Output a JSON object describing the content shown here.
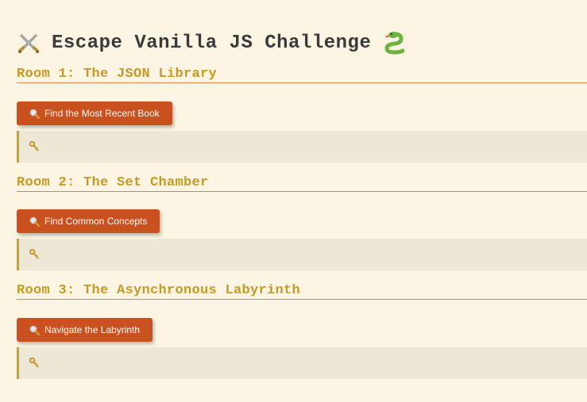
{
  "page": {
    "title": "Escape Vanilla JS Challenge",
    "title_icon_left": "crossed-swords-icon",
    "title_icon_right": "snake-icon"
  },
  "rooms": [
    {
      "title": "Room 1: The JSON Library",
      "button_label": "Find the Most Recent Book",
      "button_icon": "magnifier-icon",
      "result_icon": "key-icon",
      "result_text": ""
    },
    {
      "title": "Room 2: The Set Chamber",
      "button_label": "Find Common Concepts",
      "button_icon": "magnifier-icon",
      "result_icon": "key-icon",
      "result_text": ""
    },
    {
      "title": "Room 3: The Asynchronous Labyrinth",
      "button_label": "Navigate the Labyrinth",
      "button_icon": "magnifier-icon",
      "result_icon": "key-icon",
      "result_text": ""
    }
  ],
  "colors": {
    "background": "#fdf5e3",
    "room_title": "#c69a25",
    "button": "#c9511f",
    "result_bg": "#ede7d6",
    "result_border": "#c9a227"
  }
}
